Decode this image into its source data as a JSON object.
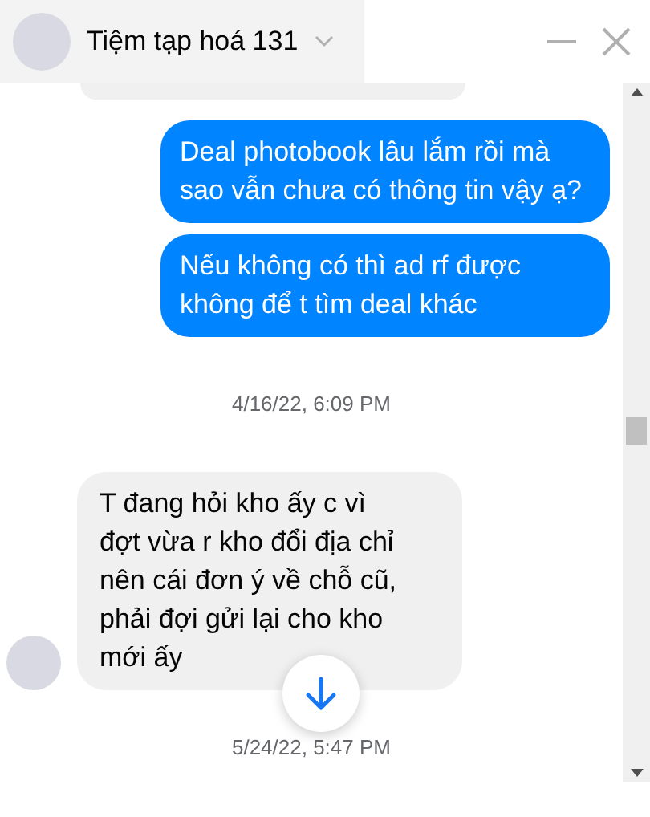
{
  "window": {
    "title": "Tiệm tạp hoá 131"
  },
  "messages": [
    {
      "kind": "outgoing",
      "text": "Deal photobook lâu lắm rồi mà sao vẫn chưa có thông tin vậy ạ?"
    },
    {
      "kind": "outgoing",
      "text": "Nếu không có thì ad rf được không để t tìm deal khác"
    },
    {
      "kind": "timestamp",
      "text": "4/16/22, 6:09 PM"
    },
    {
      "kind": "incoming",
      "text": "T đang hỏi kho ấy c vì đợt vừa r kho đổi địa chỉ nên cái đơn ý về chỗ cũ, phải đợi gửi lại cho kho mới ấy"
    },
    {
      "kind": "timestamp",
      "text": "5/24/22, 5:47 PM"
    }
  ]
}
